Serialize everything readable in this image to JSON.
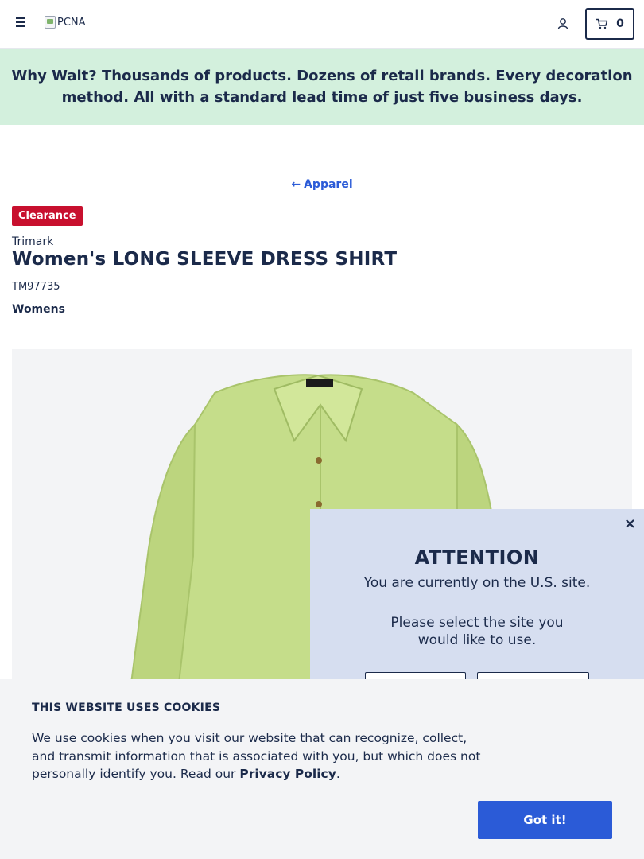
{
  "header": {
    "logo_alt": "PCNA",
    "cart_count": "0"
  },
  "banner": {
    "lead": "Why Wait?",
    "text": "Thousands of products. Dozens of retail brands. Every decoration method. All with a standard lead time of just five business days."
  },
  "product": {
    "back_label": "Apparel",
    "badge": "Clearance",
    "brand": "Trimark",
    "title": "Women's LONG SLEEVE DRESS SHIRT",
    "sku": "TM97735",
    "category": "Womens",
    "image_color": "#c5dd8a"
  },
  "attention_modal": {
    "close": "×",
    "heading": "ATTENTION",
    "current_site": "You are currently on the U.S. site.",
    "prompt": "Please select the site you would like to use."
  },
  "cookies": {
    "heading": "THIS WEBSITE USES COOKIES",
    "text": "We use cookies when you visit our website that can recognize, collect, and transmit information that is associated with you, but which does not personally identify you. Read our",
    "link": "Privacy Policy",
    "period": ".",
    "button": "Got it!"
  },
  "colors": {
    "navy": "#1b2a4a",
    "accent_blue": "#2b5bd7",
    "clearance_red": "#c8102e",
    "banner_green": "#d3f0dd",
    "modal_blue": "#d6def0"
  }
}
